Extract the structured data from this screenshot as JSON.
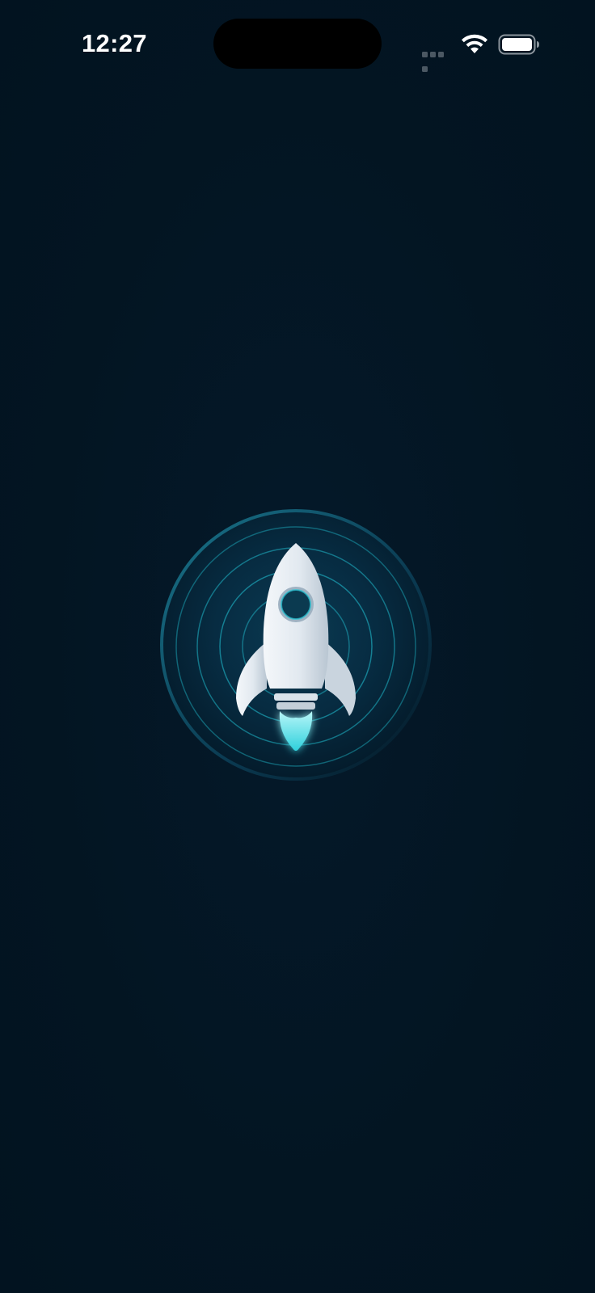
{
  "status_bar": {
    "time": "12:27",
    "icons": [
      "cellular-signal-icon",
      "wifi-icon",
      "battery-icon"
    ]
  },
  "splash": {
    "logo_icon": "rocket-icon",
    "logo_colors": {
      "ring_accent": "#1fb7c9",
      "rocket_body": "#e8eef4",
      "flame": "#5fe3ea",
      "background": "#031522"
    }
  }
}
